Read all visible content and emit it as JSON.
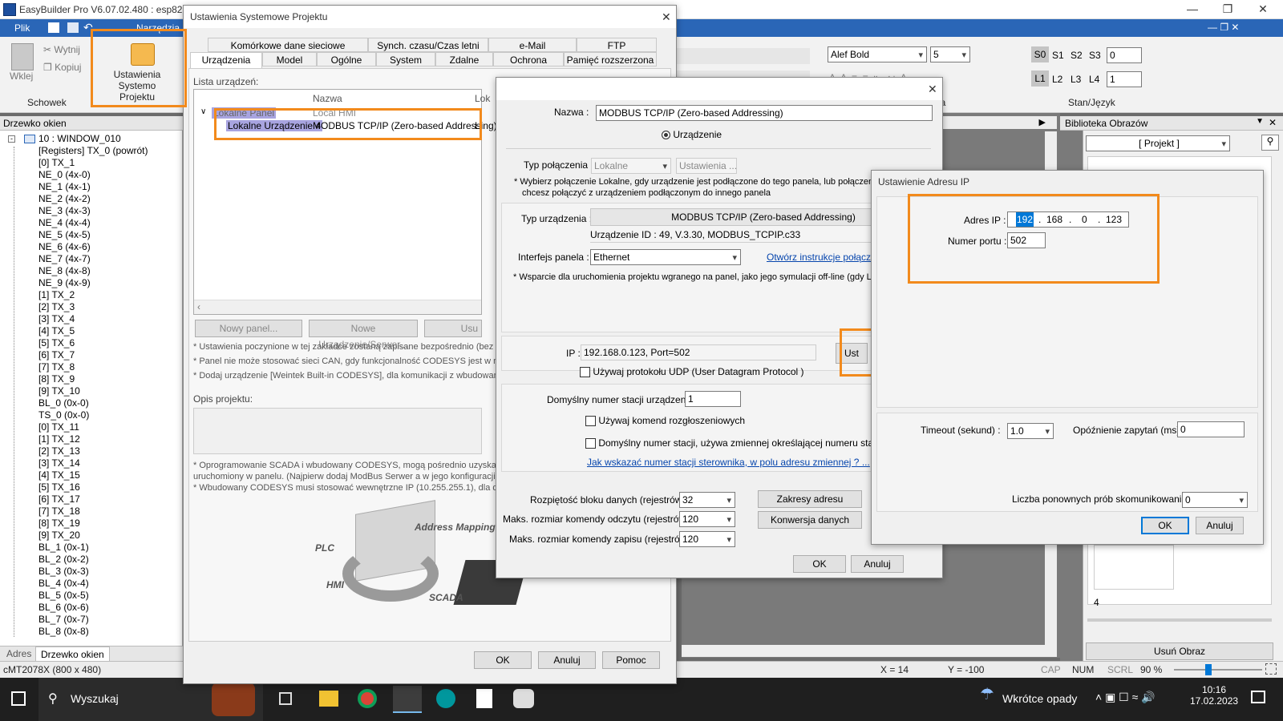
{
  "app": {
    "title": "EasyBuilder Pro V6.07.02.480 : esp8266",
    "ribbon_tabs": [
      "Plik",
      "Narzędzia"
    ]
  },
  "ribbon": {
    "cut": "Wytnij",
    "copy": "Kopiuj",
    "paste": "Wklej",
    "clipboard_group": "Schowek",
    "project_settings_l1": "Ustawienia Systemo",
    "project_settings_l2": "Projektu",
    "font_name": "Alef Bold",
    "font_size": "5",
    "stage_s": [
      "S0",
      "S1",
      "S2",
      "S3"
    ],
    "stage_l": [
      "L1",
      "L2",
      "L3",
      "L4"
    ],
    "stage_val1": "0",
    "stage_val2": "1",
    "group_state": "Stan/Język",
    "group_partial": "nka"
  },
  "left_panel": {
    "title": "Drzewko okien",
    "root": "10 : WINDOW_010",
    "items": [
      "[Registers] TX_0 (powrót)",
      "[0] TX_1",
      "NE_0 (4x-0)",
      "NE_1 (4x-1)",
      "NE_2 (4x-2)",
      "NE_3 (4x-3)",
      "NE_4 (4x-4)",
      "NE_5 (4x-5)",
      "NE_6 (4x-6)",
      "NE_7 (4x-7)",
      "NE_8 (4x-8)",
      "NE_9 (4x-9)",
      "[1] TX_2",
      "[2] TX_3",
      "[3] TX_4",
      "[4] TX_5",
      "[5] TX_6",
      "[6] TX_7",
      "[7] TX_8",
      "[8] TX_9",
      "[9] TX_10",
      "BL_0 (0x-0)",
      "TS_0 (0x-0)",
      "[0] TX_11",
      "[1] TX_12",
      "[2] TX_13",
      "[3] TX_14",
      "[4] TX_15",
      "[5] TX_16",
      "[6] TX_17",
      "[7] TX_18",
      "[8] TX_19",
      "[9] TX_20",
      "BL_1 (0x-1)",
      "BL_2 (0x-2)",
      "BL_3 (0x-3)",
      "BL_4 (0x-4)",
      "BL_5 (0x-5)",
      "BL_6 (0x-6)",
      "BL_7 (0x-7)",
      "BL_8 (0x-8)"
    ],
    "bottom_tabs": [
      "Adres",
      "Drzewko okien"
    ]
  },
  "right_panel": {
    "title": "Biblioteka Obrazów",
    "combo": "[ Projekt ]",
    "number": "4",
    "remove_button": "Usuń Obraz"
  },
  "status": {
    "model": "cMT2078X (800 x 480)",
    "x": "X = 14",
    "y": "Y = -100",
    "cap": "CAP",
    "num": "NUM",
    "scrl": "SCRL",
    "zoom": "90 %"
  },
  "taskbar": {
    "search": "Wyszukaj",
    "weather": "Wkrótce opady",
    "time": "10:16",
    "date": "17.02.2023"
  },
  "dlg1": {
    "title": "Ustawienia Systemowe Projektu",
    "tabs_row1": [
      "Komórkowe dane sieciowe",
      "Synch. czasu/Czas letni",
      "e-Mail",
      "FTP"
    ],
    "tabs_row2": [
      "Urządzenia",
      "Model",
      "Ogólne",
      "System",
      "Zdalne",
      "Ochrona",
      "Pamięć rozszerzona"
    ],
    "list_label": "Lista urządzeń:",
    "col_name": "Nazwa",
    "col_loc": "Lok",
    "row1_a": "Lokalne Panel",
    "row1_b": "Local HMI",
    "row2_a": "Lokalne Urządzenie 4",
    "row2_b": "MODBUS TCP/IP (Zero-based Addressing)",
    "row2_c": "L",
    "btn_new_panel": "Nowy panel...",
    "btn_new_device": "Nowe Urządzenie/Serwer...",
    "btn_delete": "Usu",
    "note1": "* Ustawienia poczynione w tej zakładce zostaną zapisane bezpośrednio (bez m",
    "note2": "* Panel nie może stosować sieci CAN, gdy funkcjonalność CODESYS jest w nim",
    "note3": "* Dodaj urządzenie [Weintek Built-in CODESYS], dla komunikacji z wbudowany",
    "desc_label": "Opis projektu:",
    "note4": "* Oprogramowanie SCADA i wbudowany CODESYS, mogą pośrednio uzyskać d",
    "note5": "uruchomiony w panelu. (Najpierw dodaj ModBus Serwer a w jego konfiguracji",
    "note6": "* Wbudowany CODESYS musi stosować wewnętrzne IP (10.255.255.1), dla d",
    "img_plc": "PLC",
    "img_hmi": "HMI",
    "img_scada": "SCADA",
    "img_amt": "Address Mapping T",
    "btn_ok": "OK",
    "btn_cancel": "Anuluj",
    "btn_help": "Pomoc"
  },
  "dlg2": {
    "name_label": "Nazwa :",
    "name_value": "MODBUS TCP/IP (Zero-based Addressing)",
    "radio_device": "Urządzenie",
    "conn_label": "Typ połączenia :",
    "conn_value": "Lokalne",
    "conn_settings": "Ustawienia ...",
    "conn_note1": "* Wybierz połączenie Lokalne, gdy urządzenie jest podłączone do tego panela, lub połączeni",
    "conn_note2": "chcesz połączyć z urządzeniem podłączonym do innego panela",
    "dev_type_label": "Typ urządzenia :",
    "dev_type_value": "MODBUS TCP/IP (Zero-based Addressing)",
    "dev_id": "Urządzenie ID : 49, V.3.30, MODBUS_TCPIP.c33",
    "iface_label": "Interfejs panela :",
    "iface_value": "Ethernet",
    "iface_link": "Otwórz instrukcje połączeń",
    "support_note": "* Wsparcie dla uruchomienia projektu wgranego na panel, jako jego symulacji off-line (gdy LB",
    "ip_label": "IP :",
    "ip_value": "192.168.0.123,  Port=502",
    "ip_btn": "Ust",
    "udp": "Używaj protokołu UDP (User Datagram Protocol )",
    "station_label": "Domyślny numer stacji urządzenia :",
    "station_value": "1",
    "broadcast": "Używaj komend rozgłoszeniowych",
    "station_var": "Domyślny numer stacji, używa zmiennej określającej numeru stacji",
    "station_link": "Jak wskazać numer stacji sterownika, w polu adresu zmiennej ? ...",
    "block_label": "Rozpiętość bloku danych (rejestrów) :",
    "block_value": "32",
    "read_label": "Maks. rozmiar komendy odczytu (rejestrów) :",
    "read_value": "120",
    "write_label": "Maks. rozmiar komendy zapisu (rejestrów) :",
    "write_value": "120",
    "btn_ranges": "Zakresy adresu",
    "btn_conv": "Konwersja danych",
    "btn_ok": "OK",
    "btn_cancel": "Anuluj"
  },
  "dlg3": {
    "title": "Ustawienie Adresu IP",
    "ip_label": "Adres IP :",
    "ip": [
      "192",
      "168",
      "0",
      "123"
    ],
    "port_label": "Numer portu :",
    "port": "502",
    "timeout_label": "Timeout (sekund) :",
    "timeout": "1.0",
    "delay_label": "Opóźnienie zapytań (ms) :",
    "delay": "0",
    "retry_label": "Liczba ponownych prób skomunikowania :",
    "retry": "0",
    "btn_ok": "OK",
    "btn_cancel": "Anuluj"
  },
  "colors": {
    "highlight": "#f28a1c",
    "ribbon_blue": "#2a66b7"
  }
}
